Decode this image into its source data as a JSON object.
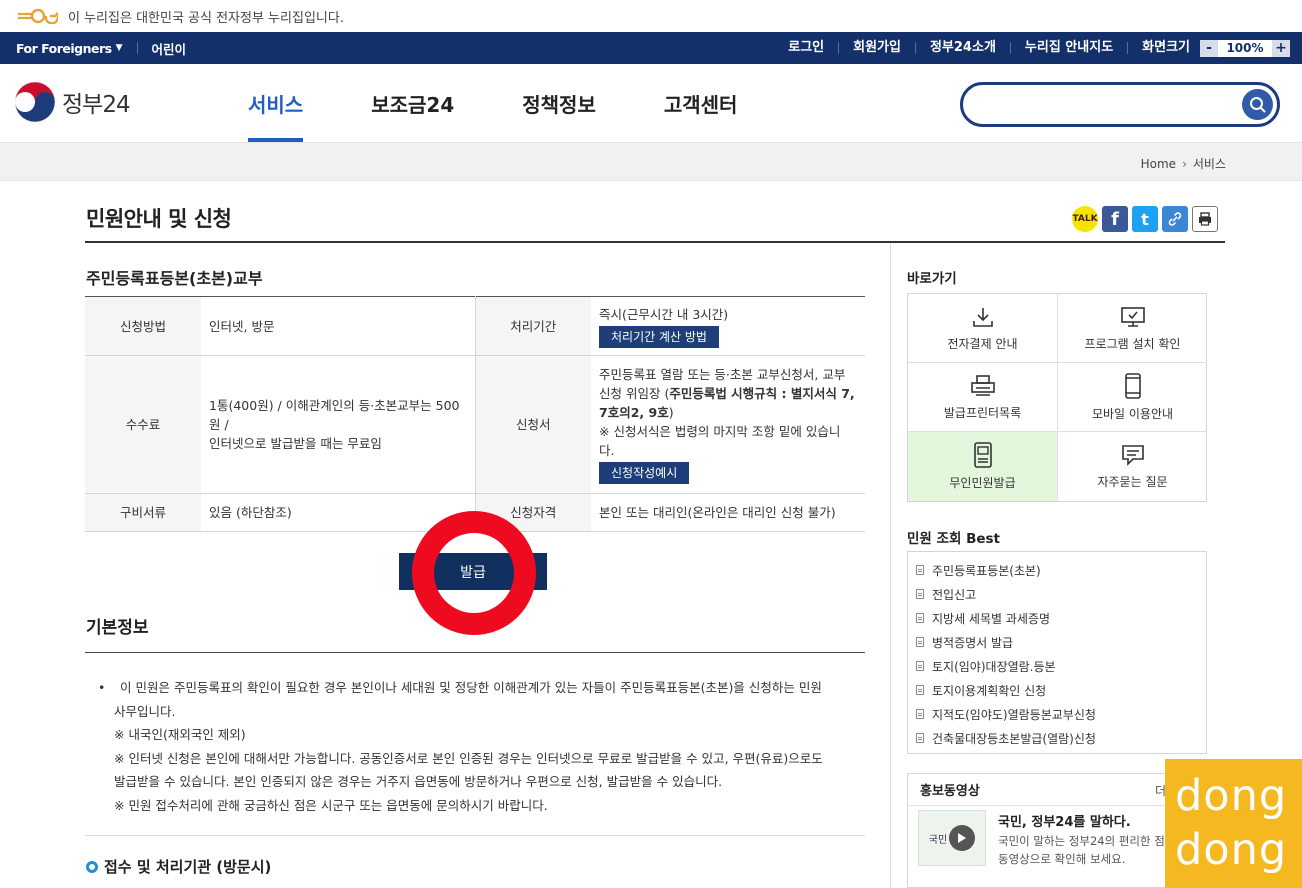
{
  "gov_banner": {
    "text": "이 누리집은 대한민국 공식 전자정부 누리집입니다."
  },
  "util": {
    "for_foreigners": "For Foreigners",
    "kids": "어린이",
    "login": "로그인",
    "signup": "회원가입",
    "about": "정부24소개",
    "sitemap": "누리집 안내지도",
    "screen_size": "화면크기",
    "zoom_minus": "-",
    "zoom_value": "100%",
    "zoom_plus": "+"
  },
  "header": {
    "logo_text": "정부24",
    "menu": [
      "서비스",
      "보조금24",
      "정책정보",
      "고객센터"
    ],
    "search_placeholder": ""
  },
  "breadcrumb": {
    "home": "Home",
    "current": "서비스"
  },
  "page": {
    "title": "민원안내 및 신청"
  },
  "share": {
    "kakao": "TALK",
    "facebook": "f",
    "twitter": "t"
  },
  "service": {
    "title": "주민등록표등본(초본)교부",
    "rows": {
      "method_label": "신청방법",
      "method_value": "인터넷, 방문",
      "period_label": "처리기간",
      "period_value": "즉시(근무시간 내 3시간)",
      "period_button": "처리기간 계산 방법",
      "fee_label": "수수료",
      "fee_value_1": "1통(400원) / 이해관계인의 등·초본교부는 500원 /",
      "fee_value_2": "인터넷으로 발급받을 때는 무료임",
      "form_label": "신청서",
      "form_value_1": "주민등록표 열람 또는 등·초본 교부신청서, 교부",
      "form_value_2a": "신청 위임장 (",
      "form_value_2b": "주민등록법 시행규칙 : 별지서식 7,",
      "form_value_3": "7호의2, 9호",
      "form_value_3b": ")",
      "form_value_4": "※ 신청서식은 법령의 마지막 조항 밑에 있습니",
      "form_value_5": "다.",
      "form_button": "신청작성예시",
      "docs_label": "구비서류",
      "docs_value": "있음 (하단참조)",
      "qual_label": "신청자격",
      "qual_value": "본인 또는 대리인(온라인은 대리인 신청 불가)"
    },
    "issue_button": "발급"
  },
  "basic": {
    "title": "기본정보",
    "bullet": "•",
    "lines": [
      "이 민원은 주민등록표의 확인이 필요한 경우 본인이나 세대원 및 정당한 이해관계가 있는 자들이 주민등록표등본(초본)을 신청하는 민원",
      "사무입니다.",
      "※ 내국인(재외국인 제외)",
      "※ 인터넷 신청은 본인에 대해서만 가능합니다. 공동인증서로 본인 인증된 경우는 인터넷으로 무료로 발급받을 수 있고, 우편(유료)으로도",
      "발급받을 수 있습니다. 본인 인증되지 않은 경우는 거주지 읍면동에 방문하거나 우편으로 신청, 발급받을 수 있습니다.",
      "※ 민원 접수처리에 관해 궁금하신 점은 시군구 또는 읍면동에 문의하시기 바랍니다."
    ],
    "office_title": "접수 및 처리기관 (방문시)"
  },
  "sidebar": {
    "quick_title": "바로가기",
    "quick": [
      "전자결제 안내",
      "프로그램 설치 확인",
      "발급프린터목록",
      "모바일 이용안내",
      "무인민원발급",
      "자주묻는 질문"
    ],
    "best_title": "민원 조회 Best",
    "best": [
      "주민등록표등본(초본)",
      "전입신고",
      "지방세 세목별 과세증명",
      "병적증명서 발급",
      "토지(임야)대장열람.등본",
      "토지이용계획확인 신청",
      "지적도(임야도)열람등본교부신청",
      "건축물대장등초본발급(열람)신청"
    ],
    "promo_title": "홍보동영상",
    "promo_more": "더",
    "promo_headline": "국민, 정부24를 말하다.",
    "promo_desc_1": "국민이 말하는 정부24의 편리한 점",
    "promo_desc_2": "동영상으로 확인해 보세요.",
    "promo_thumb_text": "국민"
  },
  "watermark": {
    "line1": "dong",
    "line2": "dong"
  },
  "colors": {
    "navy": "#13306b",
    "accent": "#1f5fbf",
    "button": "#1e3e79",
    "ring": "#ee0b1f",
    "highlight": "#e3f7dc"
  }
}
